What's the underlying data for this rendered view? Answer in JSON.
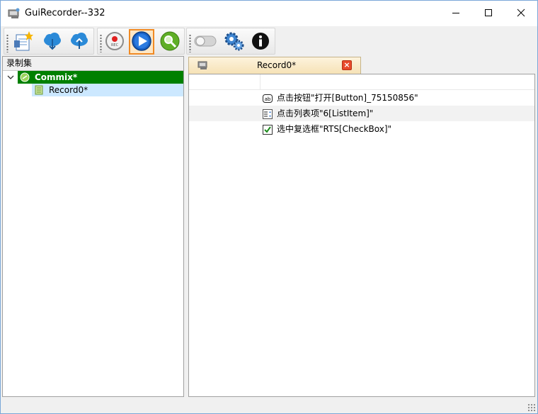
{
  "window": {
    "title": "GuiRecorder--332",
    "icon": "recorder-app-icon"
  },
  "toolbar": {
    "buttons": [
      {
        "name": "new-record-set-button",
        "icon": "new-document-star-icon"
      },
      {
        "name": "download-button",
        "icon": "cloud-download-icon"
      },
      {
        "name": "upload-button",
        "icon": "cloud-upload-icon"
      },
      {
        "name": "record-button",
        "icon": "rec-icon"
      },
      {
        "name": "play-button",
        "icon": "play-icon",
        "active": true
      },
      {
        "name": "inspect-button",
        "icon": "magnifier-icon"
      },
      {
        "name": "toggle-switch",
        "icon": "toggle-icon"
      },
      {
        "name": "settings-button",
        "icon": "gears-icon"
      },
      {
        "name": "info-button",
        "icon": "info-icon"
      }
    ]
  },
  "left_pane": {
    "header": "录制集",
    "tree": {
      "root_label": "Commix*",
      "child_label": "Record0*"
    }
  },
  "tab": {
    "title": "Record0*",
    "close_glyph": "×"
  },
  "actions": [
    {
      "icon": "button-ab-icon",
      "text": "点击按钮\"打开[Button]_75150856\""
    },
    {
      "icon": "list-item-icon",
      "text": "点击列表项\"6[ListItem]\""
    },
    {
      "icon": "checkbox-checked-icon",
      "text": "选中复选框\"RTS[CheckBox]\""
    }
  ],
  "colors": {
    "tree_root_bg": "#008000",
    "tree_selected_bg": "#cce8ff",
    "active_button_border": "#f08a24",
    "tab_bg": "#f6e2b6"
  }
}
